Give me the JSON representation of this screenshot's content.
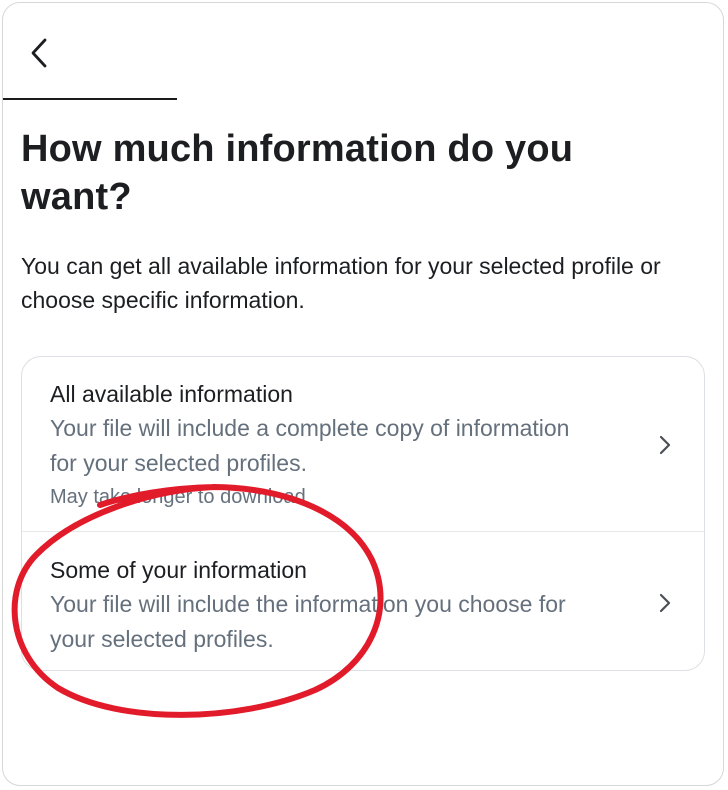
{
  "header": {
    "back_icon": "chevron-left-icon"
  },
  "page": {
    "title": "How much information do you want?",
    "subtitle": "You can get all available information for your selected profile or choose specific information."
  },
  "options": [
    {
      "title": "All available information",
      "description": "Your file will include a complete copy of information for your selected profiles.",
      "note": "May take longer to download",
      "icon": "chevron-right-icon"
    },
    {
      "title": "Some of your information",
      "description": "Your file will include the information you choose for your selected profiles.",
      "icon": "chevron-right-icon"
    }
  ],
  "colors": {
    "primary_text": "#1c1e21",
    "secondary_text": "#65707d",
    "annotation": "#e21b2a",
    "border": "#dcdfe3"
  }
}
